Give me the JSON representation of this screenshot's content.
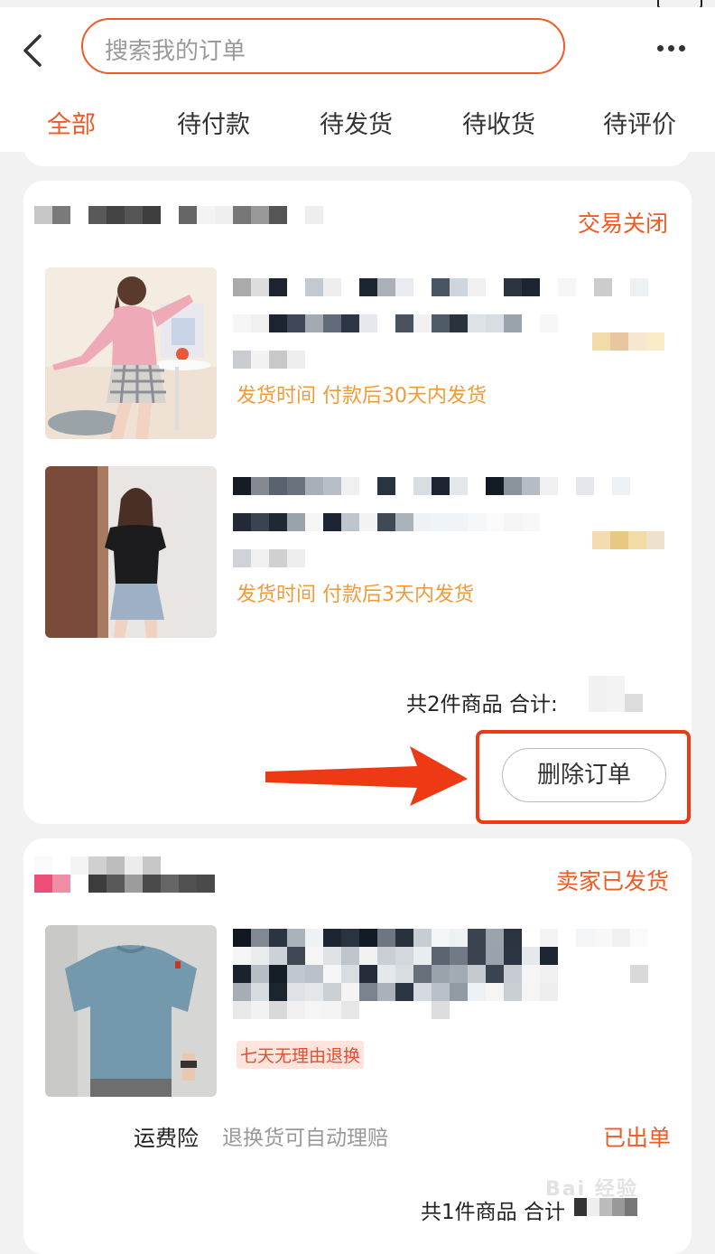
{
  "header": {
    "search_placeholder": "搜索我的订单"
  },
  "tabs": [
    {
      "label": "全部",
      "active": true
    },
    {
      "label": "待付款"
    },
    {
      "label": "待发货"
    },
    {
      "label": "待收货"
    },
    {
      "label": "待评价"
    }
  ],
  "orders": [
    {
      "status": "交易关闭",
      "items": [
        {
          "shipping_note": "发货时间 付款后30天内发货"
        },
        {
          "shipping_note": "发货时间 付款后3天内发货"
        }
      ],
      "total_label": "共2件商品 合计:",
      "delete_button": "删除订单"
    },
    {
      "status": "卖家已发货",
      "items": [
        {
          "tag": "七天无理由退换"
        }
      ],
      "insurance_label": "运费险",
      "insurance_desc": "退换货可自动理赔",
      "insurance_status": "已出单",
      "total_label": "共1件商品 合计"
    }
  ],
  "watermark": "Bai 经验",
  "colors": {
    "accent": "#f05a24",
    "highlight": "#ee3a14",
    "shipping_text": "#f39a38"
  }
}
